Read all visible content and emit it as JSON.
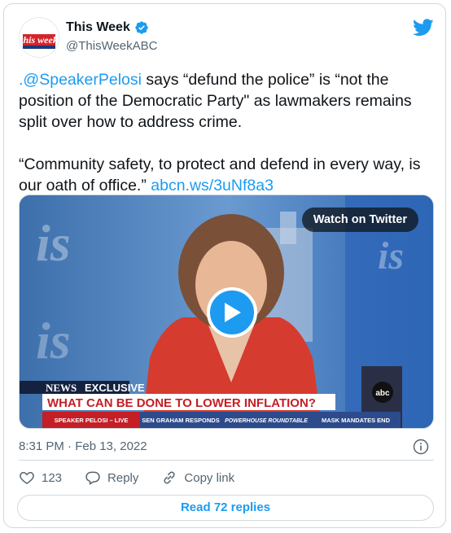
{
  "author": {
    "display_name": "This Week",
    "handle": "@ThisWeekABC",
    "avatar_text": "this week",
    "verified": true
  },
  "tweet": {
    "mention": ".@SpeakerPelosi",
    "text_1": " says “defund the police” is “not the position of the Democratic Party\" as lawmakers remains split over how to address crime.",
    "text_2": "“Community safety, to protect and defend in every way, is our oath of office.” ",
    "link": "abcn.ws/3uNf8a3"
  },
  "media": {
    "watch_label": "Watch on Twitter",
    "chyron_network": "NEWS",
    "chyron_tag": "EXCLUSIVE",
    "chyron_headline": "WHAT CAN BE DONE TO LOWER INFLATION?",
    "ticker": [
      "SPEAKER PELOSI – LIVE",
      "SEN GRAHAM RESPONDS",
      "POWERHOUSE ROUNDTABLE",
      "MASK MANDATES END"
    ],
    "abc_bug": "abc"
  },
  "meta": {
    "timestamp": "8:31 PM · Feb 13, 2022"
  },
  "actions": {
    "like_count": "123",
    "reply_label": "Reply",
    "copy_label": "Copy link",
    "read_replies": "Read 72 replies"
  },
  "colors": {
    "accent": "#1d9bf0",
    "text": "#0f1419",
    "secondary": "#536471",
    "border": "#cfd9de"
  }
}
